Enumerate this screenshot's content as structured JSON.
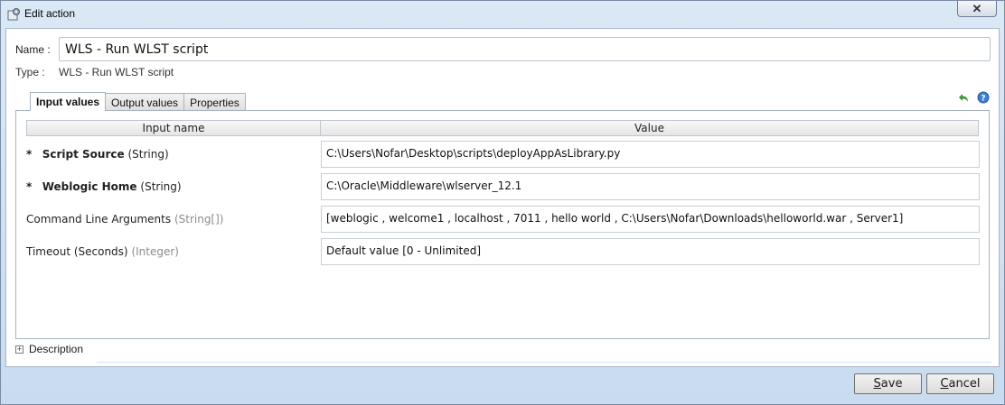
{
  "window": {
    "title": "Edit action",
    "close_glyph": "✕"
  },
  "form": {
    "name_label": "Name :",
    "name_value": "WLS - Run WLST script",
    "type_label": "Type :",
    "type_value": "WLS - Run WLST script"
  },
  "tabs": [
    {
      "label": "Input values",
      "active": true
    },
    {
      "label": "Output values",
      "active": false
    },
    {
      "label": "Properties",
      "active": false
    }
  ],
  "grid": {
    "col_name": "Input name",
    "col_value": "Value",
    "rows": [
      {
        "required": "*",
        "name": "Script Source",
        "type": "(String)",
        "value": "C:\\Users\\Nofar\\Desktop\\scripts\\deployAppAsLibrary.py"
      },
      {
        "required": "*",
        "name": "Weblogic Home",
        "type": "(String)",
        "value": "C:\\Oracle\\Middleware\\wlserver_12.1"
      },
      {
        "required": "",
        "name": "Command Line Arguments",
        "type": "(String[])",
        "value": "[weblogic , welcome1 , localhost , 7011 , hello world , C:\\Users\\Nofar\\Downloads\\helloworld.war , Server1]"
      },
      {
        "required": "",
        "name": "Timeout (Seconds)",
        "type": "(Integer)",
        "value": "Default value [0 - Unlimited]"
      }
    ]
  },
  "description": {
    "toggle": "+",
    "label": "Description"
  },
  "buttons": {
    "save_mnemonic": "S",
    "save_rest": "ave",
    "cancel_mnemonic": "C",
    "cancel_rest": "ancel"
  },
  "icons": {
    "title": "edit-action-icon",
    "undo": "undo-arrow-icon",
    "help": "help-icon"
  },
  "colors": {
    "accent_green": "#3a9a3a",
    "help_blue": "#3e7fd1"
  }
}
